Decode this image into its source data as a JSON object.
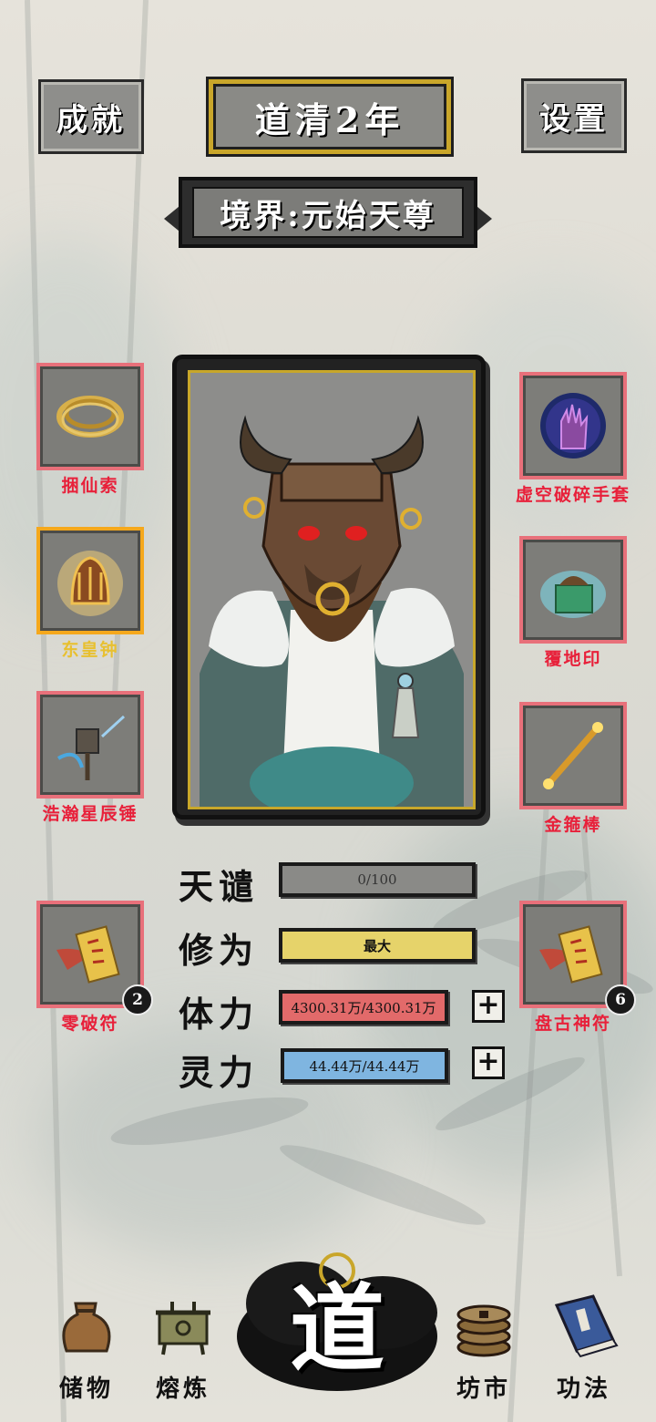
{
  "header": {
    "achievements_label": "成就",
    "year_title": "道清2年",
    "settings_label": "设置",
    "realm": "境界:元始天尊"
  },
  "equipment_left": [
    {
      "name": "捆仙索",
      "icon": "rope-icon",
      "rarity": "red"
    },
    {
      "name": "东皇钟",
      "icon": "bell-icon",
      "rarity": "gold"
    },
    {
      "name": "浩瀚星辰锤",
      "icon": "hammer-icon",
      "rarity": "red"
    }
  ],
  "equipment_right": [
    {
      "name": "虚空破碎手套",
      "icon": "glove-icon",
      "rarity": "red"
    },
    {
      "name": "覆地印",
      "icon": "seal-icon",
      "rarity": "red"
    },
    {
      "name": "金箍棒",
      "icon": "staff-icon",
      "rarity": "red"
    }
  ],
  "talismans": [
    {
      "name": "零破符",
      "count": "2",
      "icon": "talisman-icon"
    },
    {
      "name": "盘古神符",
      "count": "6",
      "icon": "talisman-icon"
    }
  ],
  "stats": {
    "tribulation": {
      "label": "天谴",
      "value": "0/100",
      "color": "#8a8a87"
    },
    "cultivation": {
      "label": "修为",
      "value": "最大",
      "color": "#e6d36a"
    },
    "stamina": {
      "label": "体力",
      "value": "4300.31万/4300.31万",
      "color": "#e26a6a"
    },
    "spirit": {
      "label": "灵力",
      "value": "44.44万/44.44万",
      "color": "#7fb5e0"
    }
  },
  "plus_symbol": "+",
  "nav": {
    "storage": "储物",
    "smelting": "熔炼",
    "center": "道",
    "market": "坊市",
    "techniques": "功法"
  },
  "colors": {
    "slot_border_red": "#e8707a",
    "slot_border_gold": "#f5a81c",
    "label_red": "#e8203a",
    "label_gold": "#e8c030",
    "frame_gold": "#c8a72a"
  }
}
